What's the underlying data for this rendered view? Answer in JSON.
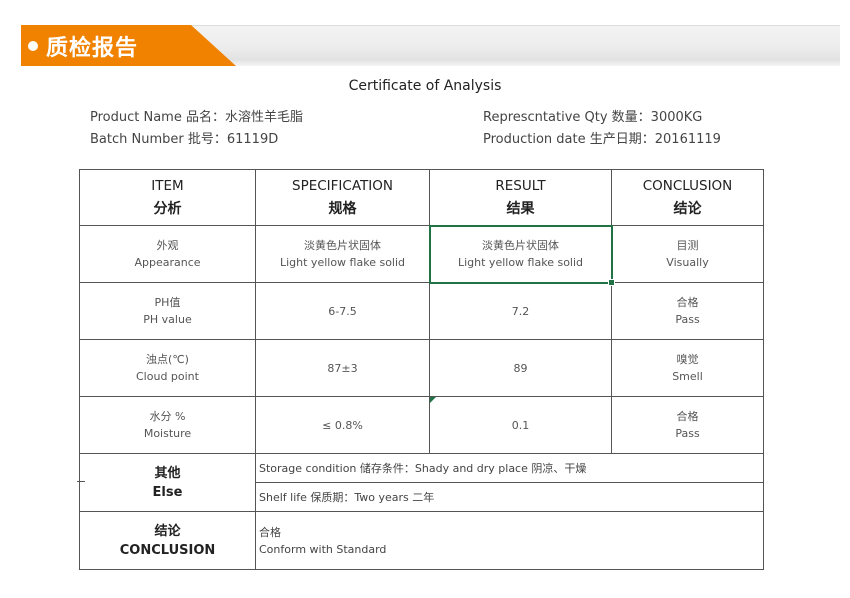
{
  "banner": {
    "title": "质检报告",
    "accent_color": "#f08200"
  },
  "document": {
    "title": "Certificate of Analysis",
    "meta_left": [
      {
        "label": "Product Name 品名：",
        "value": "水溶性羊毛脂"
      },
      {
        "label": "Batch Number 批号：",
        "value": "61119D"
      }
    ],
    "meta_right": [
      {
        "label": "Represcntative Qty 数量：",
        "value": "3000KG"
      },
      {
        "label": "Production date 生产日期：",
        "value": "20161119"
      }
    ]
  },
  "table": {
    "headers": [
      {
        "en": "ITEM",
        "cn": "分析"
      },
      {
        "en": "SPECIFICATION",
        "cn": "规格"
      },
      {
        "en": "RESULT",
        "cn": "结果"
      },
      {
        "en": "CONCLUSION",
        "cn": "结论"
      }
    ],
    "rows": [
      {
        "item_cn": "外观",
        "item_en": "Appearance",
        "spec_cn": "淡黄色片状固体",
        "spec_en": "Light yellow flake solid",
        "result_cn": "淡黄色片状固体",
        "result_en": "Light yellow flake solid",
        "concl_cn": "目测",
        "concl_en": "Visually"
      },
      {
        "item_cn": "PH值",
        "item_en": "PH value",
        "spec": "6-7.5",
        "result": "7.2",
        "concl_cn": "合格",
        "concl_en": "Pass"
      },
      {
        "item_cn": "浊点(℃)",
        "item_en": "Cloud point",
        "spec": "87±3",
        "result": "89",
        "concl_cn": "嗅觉",
        "concl_en": "Smell"
      },
      {
        "item_cn": "水分 %",
        "item_en": "Moisture",
        "spec": "≤ 0.8%",
        "result": "0.1",
        "concl_cn": "合格",
        "concl_en": "Pass"
      }
    ],
    "else": {
      "label_cn": "其他",
      "label_en": "Else",
      "storage": "Storage condition 储存条件：Shady and dry place 阴凉、干燥",
      "shelf_life": "Shelf life 保质期：Two years 二年"
    },
    "conclusion": {
      "label_cn": "结论",
      "label_en": "CONCLUSION",
      "value_cn": "合格",
      "value_en": "Conform with Standard"
    }
  }
}
